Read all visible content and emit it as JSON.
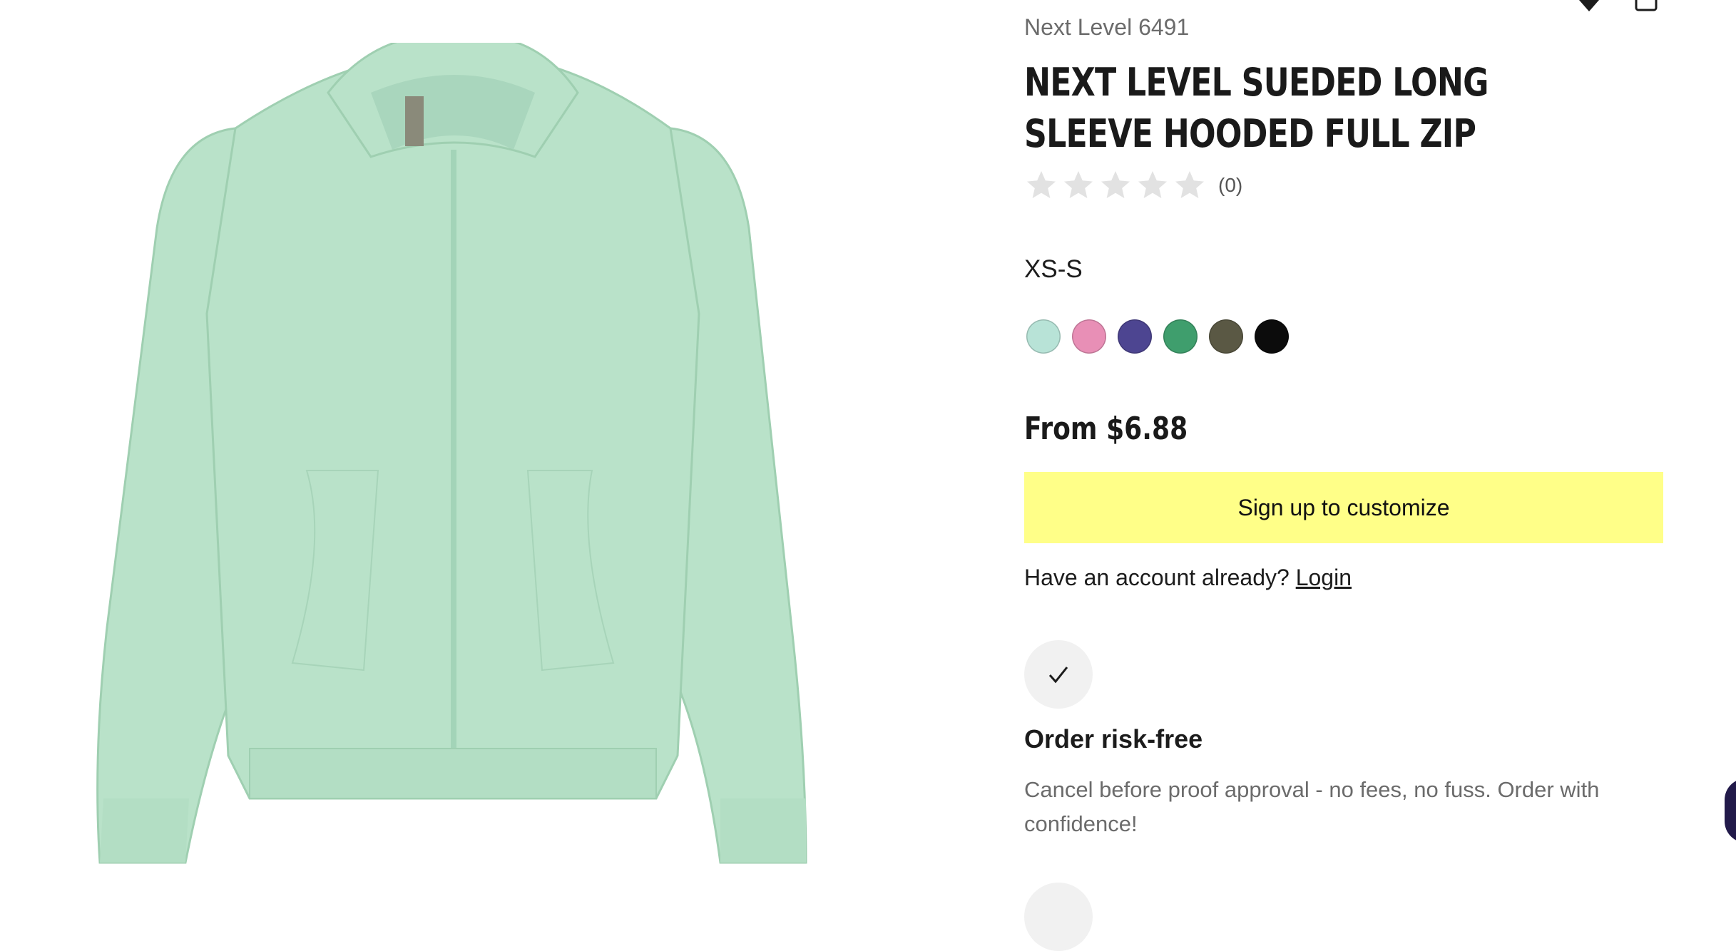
{
  "product": {
    "sku_label": "Next Level 6491",
    "title": "NEXT LEVEL SUEDED LONG SLEEVE HOODED FULL ZIP",
    "rating": {
      "stars": 0,
      "max": 5,
      "count_label": "(0)"
    },
    "size_range": "XS-S",
    "swatches": [
      {
        "name": "mint",
        "color": "#b8e3d7"
      },
      {
        "name": "pink",
        "color": "#e88fb6"
      },
      {
        "name": "purple",
        "color": "#4d4591"
      },
      {
        "name": "green",
        "color": "#3f9e6d"
      },
      {
        "name": "olive",
        "color": "#5a5844"
      },
      {
        "name": "black",
        "color": "#0c0c0c"
      }
    ],
    "price": "From $6.88",
    "image_color": "#b9e2c9"
  },
  "cta": {
    "signup_label": "Sign up to customize",
    "signup_color": "#ffff88"
  },
  "account": {
    "prompt": "Have an account already?",
    "login_label": "Login"
  },
  "feature": {
    "icon": "check-icon",
    "title": "Order risk-free",
    "description": "Cancel before proof approval - no fees, no fuss. Order with confidence!"
  },
  "header_icons": [
    "wishlist-icon",
    "cart-icon"
  ]
}
